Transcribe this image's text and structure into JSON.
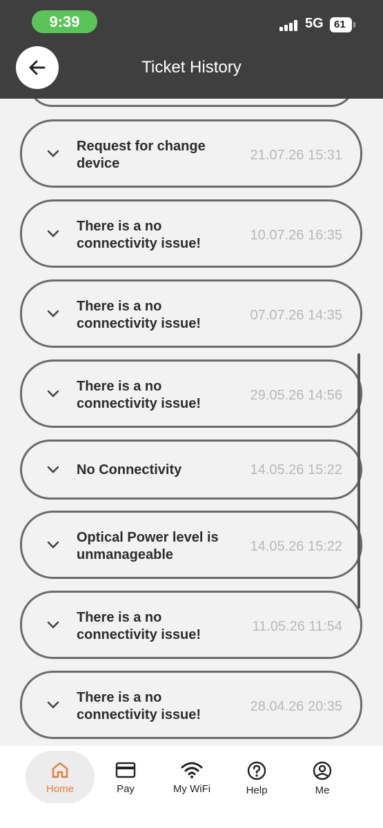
{
  "status_bar": {
    "time": "9:39",
    "network": "5G",
    "battery": "61"
  },
  "header": {
    "title": "Ticket History"
  },
  "tickets": [
    {
      "label": "Request for change device",
      "date": "21.07.26 15:31"
    },
    {
      "label": "There is a no connectivity issue!",
      "date": "10.07.26 16:35"
    },
    {
      "label": "There is a no connectivity issue!",
      "date": "07.07.26 14:35"
    },
    {
      "label": "There is a no connectivity issue!",
      "date": "29.05.26 14:56"
    },
    {
      "label": "No Connectivity",
      "date": "14.05.26 15:22"
    },
    {
      "label": "Optical Power level is unmanageable",
      "date": "14.05.26 15:22"
    },
    {
      "label": "There is a no connectivity issue!",
      "date": "11.05.26 11:54"
    },
    {
      "label": "There is a no connectivity issue!",
      "date": "28.04.26 20:35"
    }
  ],
  "nav": {
    "items": [
      {
        "label": "Home",
        "icon": "home-icon",
        "active": true
      },
      {
        "label": "Pay",
        "icon": "card-icon"
      },
      {
        "label": "My WiFi",
        "icon": "wifi-icon"
      },
      {
        "label": "Help",
        "icon": "help-icon"
      },
      {
        "label": "Me",
        "icon": "user-icon"
      }
    ]
  },
  "colors": {
    "header": "#3f3f3f",
    "accent": "#e57a3a",
    "time_pill": "#5ac45a"
  }
}
